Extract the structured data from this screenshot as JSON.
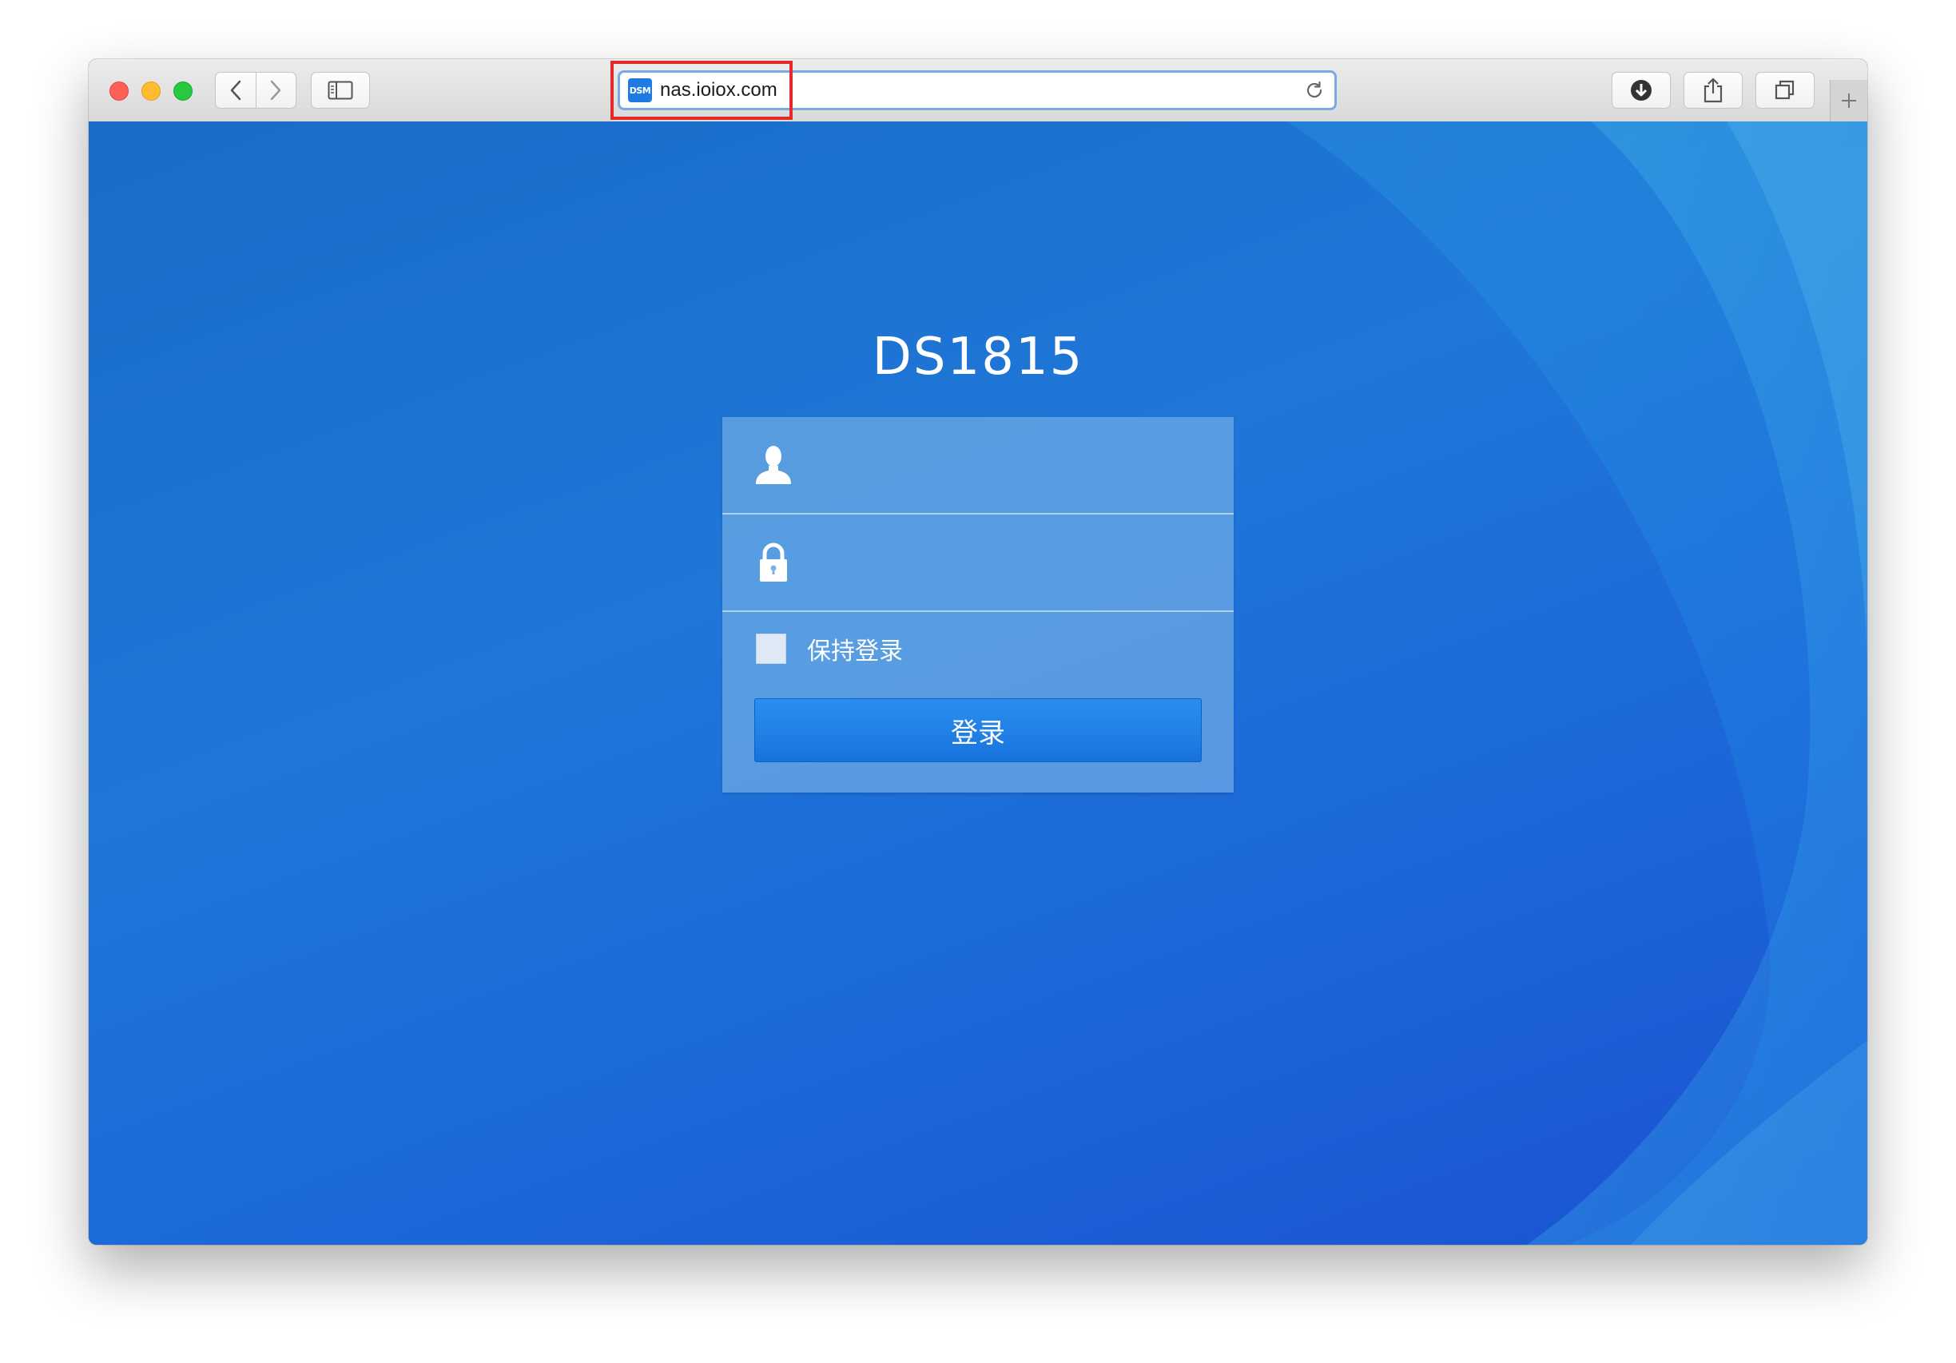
{
  "browser": {
    "url": "nas.ioiox.com",
    "favicon_text": "DSM",
    "accent_color": "#7aa9e8",
    "highlight_color": "#e32b2b"
  },
  "page": {
    "title": "DS1815",
    "username_placeholder": "",
    "password_placeholder": "",
    "remember_label": "保持登录",
    "remember_checked": false,
    "login_button_label": "登录",
    "background_color": "#1f77d8",
    "button_color": "#1f80e8"
  }
}
